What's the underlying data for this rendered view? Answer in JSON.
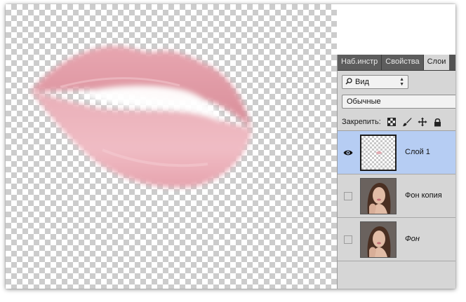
{
  "panel": {
    "tabs": [
      {
        "label": "Наб.инстр",
        "active": false
      },
      {
        "label": "Свойства",
        "active": false
      },
      {
        "label": "Слои",
        "active": true
      }
    ],
    "filter": {
      "value": "Вид",
      "icon": "search-icon"
    },
    "blend_mode": {
      "value": "Обычные"
    },
    "lock": {
      "label": "Закрепить:",
      "icons": [
        "lock-transparent-pixels-icon",
        "lock-image-pixels-icon",
        "lock-position-icon",
        "lock-all-icon"
      ]
    },
    "layers": [
      {
        "name": "Слой 1",
        "selected": true,
        "visible": true,
        "italic": false,
        "thumbnail": "transparent-with-lips"
      },
      {
        "name": "Фон копия",
        "selected": false,
        "visible": false,
        "italic": false,
        "thumbnail": "portrait-photo"
      },
      {
        "name": "Фон",
        "selected": false,
        "visible": false,
        "italic": true,
        "thumbnail": "portrait-photo"
      }
    ]
  },
  "colors": {
    "lips": "#e3a4ad",
    "selection": "#b6cdf3",
    "panel_bg": "#d6d6d6",
    "tab_bar": "#535353"
  }
}
